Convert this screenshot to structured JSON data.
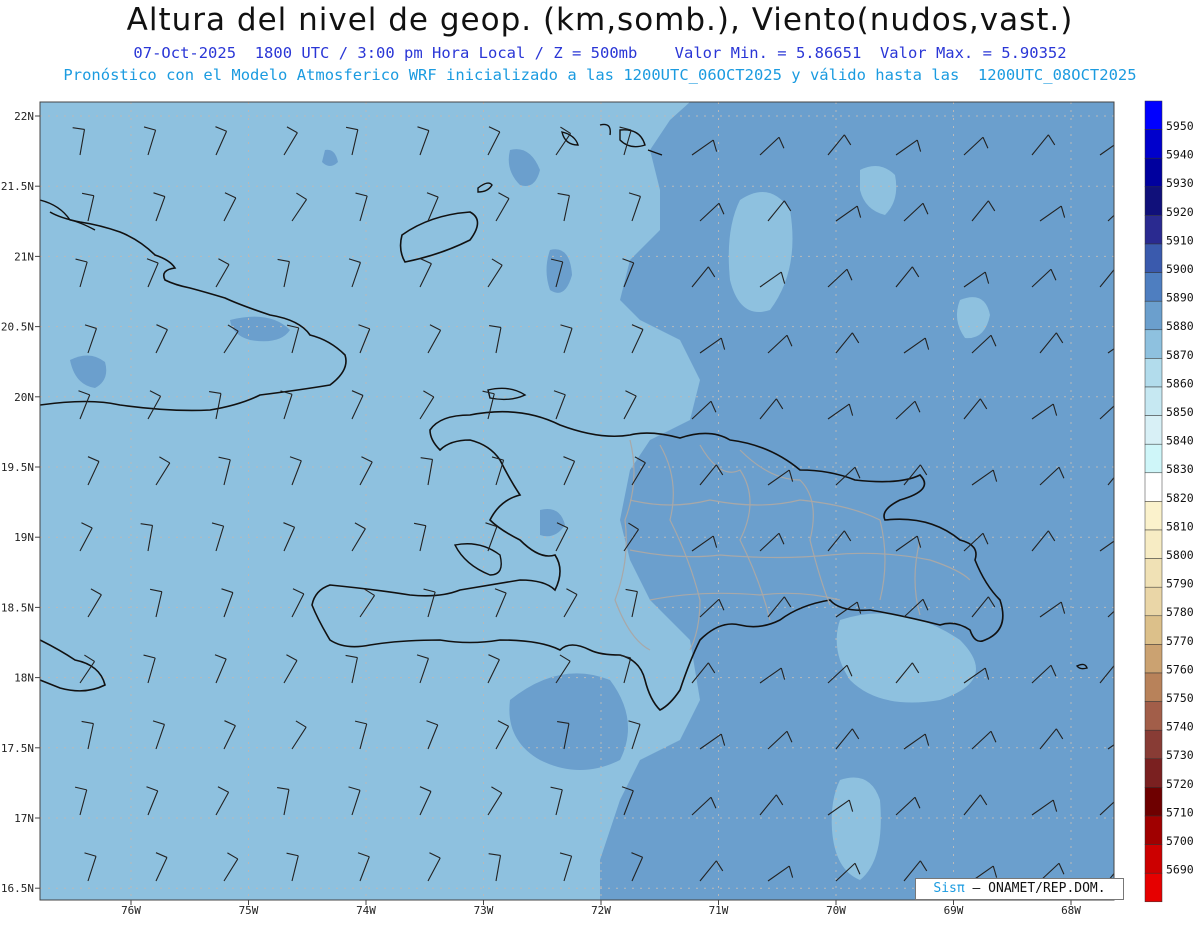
{
  "header": {
    "title": "Altura del nivel de geop. (km,somb.), Viento(nudos,vast.)",
    "subtitle_line1": "07-Oct-2025  1800 UTC / 3:00 pm Hora Local / Z = 500mb    Valor Min. = 5.86651  Valor Max. = 5.90352",
    "subtitle_line2": "Pronóstico con el Modelo Atmosferico WRF inicializado a las 1200UTC_06OCT2025 y válido hasta las  1200UTC_08OCT2025"
  },
  "map": {
    "lat_labels": [
      "22N",
      "21.5N",
      "21N",
      "20.5N",
      "20N",
      "19.5N",
      "19N",
      "18.5N",
      "18N",
      "17.5N",
      "17N",
      "16.5N"
    ],
    "lon_labels": [
      "76W",
      "75W",
      "74W",
      "73W",
      "72W",
      "71W",
      "70W",
      "69W",
      "68W"
    ],
    "colors": {
      "ocean_base": "#8ec1df",
      "field_5880": "#6b9fcd",
      "field_5870_light": "#9cc9e4",
      "coast": "#111111",
      "provinces": "#a8a8a8",
      "gridline": "#b9b9b9",
      "barb": "#222222"
    }
  },
  "colorbar": {
    "levels": [
      {
        "value": "5950",
        "color": "#0000ff"
      },
      {
        "value": "5940",
        "color": "#0000cc"
      },
      {
        "value": "5930",
        "color": "#00009e"
      },
      {
        "value": "5920",
        "color": "#10107a"
      },
      {
        "value": "5910",
        "color": "#2a2a90"
      },
      {
        "value": "5900",
        "color": "#3a5aad"
      },
      {
        "value": "5890",
        "color": "#4e7ec0"
      },
      {
        "value": "5880",
        "color": "#6b9fcd"
      },
      {
        "value": "5870",
        "color": "#8ec1df"
      },
      {
        "value": "5860",
        "color": "#b2dcec"
      },
      {
        "value": "5850",
        "color": "#c6e8f2"
      },
      {
        "value": "5840",
        "color": "#d8f0f6"
      },
      {
        "value": "5830",
        "color": "#cff6f9"
      },
      {
        "value": "5820",
        "color": "#ffffff"
      },
      {
        "value": "5810",
        "color": "#fbf2cc"
      },
      {
        "value": "5800",
        "color": "#f7ecc4"
      },
      {
        "value": "5790",
        "color": "#f0e1b5"
      },
      {
        "value": "5780",
        "color": "#ead6a7"
      },
      {
        "value": "5770",
        "color": "#dcc08a"
      },
      {
        "value": "5760",
        "color": "#cba271"
      },
      {
        "value": "5750",
        "color": "#b8825a"
      },
      {
        "value": "5740",
        "color": "#a25e49"
      },
      {
        "value": "5730",
        "color": "#883c35"
      },
      {
        "value": "5720",
        "color": "#7a2020"
      },
      {
        "value": "5710",
        "color": "#6e0000"
      },
      {
        "value": "5700",
        "color": "#a00000"
      },
      {
        "value": "5690",
        "color": "#cc0000"
      },
      {
        "value": "",
        "color": "#e60000"
      }
    ]
  },
  "credit": {
    "brand": "Sisπ",
    "org": "– ONAMET/REP.DOM."
  }
}
